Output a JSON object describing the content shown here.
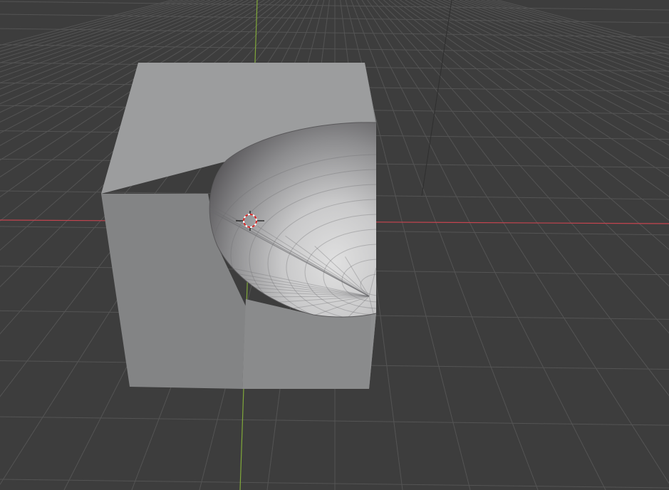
{
  "viewport": {
    "view": "3d-viewport",
    "background_color": "#3d3d3d",
    "grid_color": "#545454",
    "x_axis_color": "#c5444f",
    "y_axis_color": "#80a83a",
    "z_axis_color": "#2f2f2f",
    "object": {
      "shape": "cube-with-spherical-cutout",
      "face_top_color": "#9c9d9e",
      "face_front_color": "#838485",
      "face_right_color": "#8e8f90",
      "cavity_dark_color": "#4f4d50",
      "cavity_light_color": "#dcdcdc"
    },
    "cursor_icon": "3d-cursor-icon"
  }
}
